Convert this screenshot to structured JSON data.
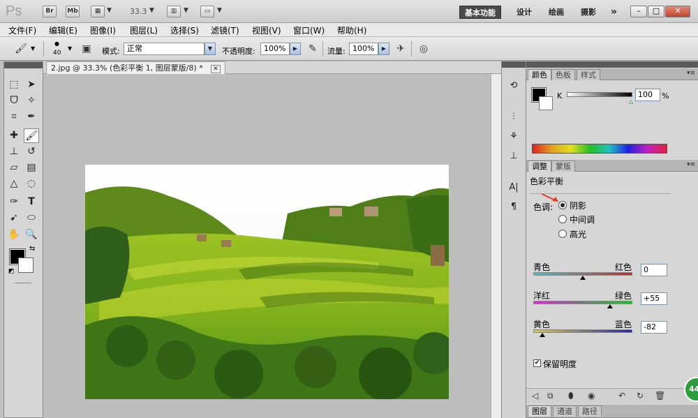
{
  "app": {
    "logo": "Ps",
    "bridge": "Br",
    "minibridge": "Mb",
    "zoom": "33.3"
  },
  "workspaces": [
    "基本功能",
    "设计",
    "绘画",
    "摄影"
  ],
  "workspace_more": "»",
  "window": {
    "min": "–",
    "max": "□",
    "close": "✕"
  },
  "menu": [
    "文件(F)",
    "编辑(E)",
    "图像(I)",
    "图层(L)",
    "选择(S)",
    "滤镜(T)",
    "视图(V)",
    "窗口(W)",
    "帮助(H)"
  ],
  "options": {
    "brush_size": "40",
    "mode_label": "模式:",
    "mode_value": "正常",
    "opacity_label": "不透明度:",
    "opacity_value": "100%",
    "flow_label": "流量:",
    "flow_value": "100%"
  },
  "document": {
    "tab_title": "2.jpg @ 33.3% (色彩平衡 1, 图层蒙版/8) *",
    "close": "✕"
  },
  "color_panel": {
    "tabs": [
      "颜色",
      "色板",
      "样式"
    ],
    "channel_label": "K",
    "value": "100",
    "unit": "%"
  },
  "adjust_panel": {
    "tabs": [
      "调整",
      "蒙版"
    ],
    "title": "色彩平衡",
    "tone_label": "色调:",
    "tones": [
      "阴影",
      "中间调",
      "高光"
    ],
    "selected_tone": 0,
    "sliders": [
      {
        "left": "青色",
        "right": "红色",
        "value": "0",
        "level": 0
      },
      {
        "left": "洋红",
        "right": "绿色",
        "value": "+55",
        "level": 55
      },
      {
        "left": "黄色",
        "right": "蓝色",
        "value": "-82",
        "level": -82
      }
    ],
    "preserve_label": "保留明度",
    "preserve_checked": true
  },
  "layers_panel": {
    "tabs": [
      "图层",
      "通道",
      "路径"
    ]
  },
  "badge": "44",
  "colors": {
    "accent_red": "#e23a2a",
    "workspace_active": "#4a4a4a"
  }
}
